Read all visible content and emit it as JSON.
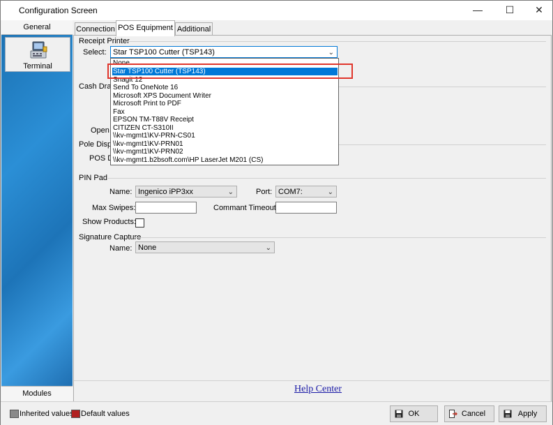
{
  "window": {
    "title": "Configuration Screen",
    "minimize_glyph": "—",
    "maximize_glyph": "☐",
    "close_glyph": "✕"
  },
  "left_panel": {
    "header": "General",
    "item_label": "Terminal",
    "footer": "Modules"
  },
  "tabs": [
    {
      "label": "Connection"
    },
    {
      "label": "POS Equipment"
    },
    {
      "label": "Additional"
    }
  ],
  "receipt_printer": {
    "section_title": "Receipt Printer",
    "select_label": "Select:",
    "selected_value": "Star TSP100 Cutter (TSP143)",
    "options": [
      "None",
      "Star TSP100 Cutter (TSP143)",
      "Snagit 12",
      "Send To OneNote 16",
      "Microsoft XPS Document Writer",
      "Microsoft Print to PDF",
      "Fax",
      "EPSON TM-T88V Receipt",
      "CITIZEN CT-S310II",
      "\\\\kv-mgmt1\\KV-PRN-CS01",
      "\\\\kv-mgmt1\\KV-PRN01",
      "\\\\kv-mgmt1\\KV-PRN02",
      "\\\\kv-mgmt1.b2bsoft.com\\HP LaserJet M201 (CS)"
    ],
    "highlighted_index": 1
  },
  "cash_drawer": {
    "section_title_visible": "Cash Draw",
    "open_label_visible": "Open"
  },
  "pole_display": {
    "section_title_visible": "Pole Displa",
    "pos_label_visible": "POS D"
  },
  "pin_pad": {
    "section_title": "PIN Pad",
    "name_label": "Name:",
    "name_value": "Ingenico iPP3xx",
    "port_label": "Port:",
    "port_value": "COM7:",
    "max_swipes_label": "Max Swipes:",
    "max_swipes_value": "",
    "timeout_label": "Commant Timeout:",
    "timeout_value": "",
    "show_products_label": "Show Products:",
    "show_products_checked": false
  },
  "signature_capture": {
    "section_title": "Signature Capture",
    "name_label": "Name:",
    "name_value": "None"
  },
  "help_link": "Help Center",
  "status": {
    "inherited_label": "Inherited values",
    "default_label": "Default values",
    "inherited_color": "#8a8a8a",
    "default_color": "#b02020"
  },
  "buttons": {
    "ok": "OK",
    "cancel": "Cancel",
    "apply": "Apply"
  },
  "icons": [
    "terminal-icon",
    "save-icon",
    "exit-icon",
    "chevron-down-icon"
  ]
}
